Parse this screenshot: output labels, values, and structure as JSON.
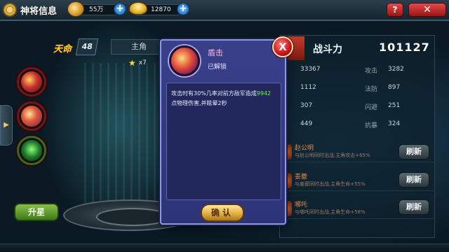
{
  "header": {
    "title": "神将信息",
    "silver": "55万",
    "gold": "12870",
    "help_label": "?",
    "close_label": "✕"
  },
  "hero": {
    "fate_label": "天命",
    "level": "48",
    "role_tab": "主角",
    "stars": "x7",
    "side_tab_arrow": "▶",
    "upgrade_label": "升星"
  },
  "stats": {
    "power_label": "战斗力",
    "power_value": "101127",
    "rows": [
      {
        "value_left": "33367",
        "label_right": "攻击",
        "value_right": "3282"
      },
      {
        "value_left": "1112",
        "label_right": "法防",
        "value_right": "897"
      },
      {
        "value_left": "307",
        "label_right": "闪避",
        "value_right": "251"
      },
      {
        "value_left": "449",
        "label_right": "抗暴",
        "value_right": "324"
      }
    ]
  },
  "bonds": [
    {
      "name": "赵公明",
      "desc": "与赵公明同时出战,主角攻击+65%",
      "refresh": "刷新"
    },
    {
      "name": "姜夔",
      "desc": "与姜夔同时出战,主角生命+55%",
      "refresh": "刷新"
    },
    {
      "name": "哪吒",
      "desc": "与哪吒同时出战,主角生命+58%",
      "refresh": "刷新"
    }
  ],
  "dialog": {
    "skill_name": "盾击",
    "status": "已解锁",
    "desc_part1": "攻击时有30%几率对前方敌军造成",
    "desc_highlight": "9942",
    "desc_part2": "点物理伤害,并眩晕2秒",
    "close_label": "X",
    "confirm_label": "确认"
  },
  "colors": {
    "dialog_bg": "#3a3f8a",
    "highlight": "#5dff4a",
    "confirm": "#e3b042",
    "close": "#d01a1a"
  }
}
